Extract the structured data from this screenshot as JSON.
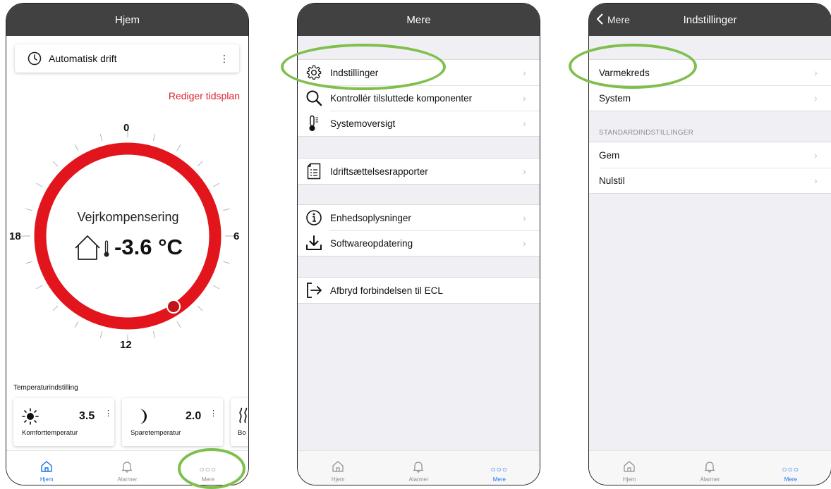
{
  "screen1": {
    "title": "Hjem",
    "mode_label": "Automatisk drift",
    "edit_schedule": "Rediger tidsplan",
    "dial": {
      "ticks": {
        "top": "0",
        "right": "6",
        "bottom": "12",
        "left": "18"
      },
      "title": "Vejrkompensering",
      "temperature": "-3.6 °C"
    },
    "section_label": "Temperaturindstilling",
    "cards": [
      {
        "value": "3.5",
        "name": "Komforttemperatur",
        "icon": "sun-icon"
      },
      {
        "value": "2.0",
        "name": "Sparetemperatur",
        "icon": "moon-icon"
      },
      {
        "value": "",
        "name": "Bo",
        "icon": "heat-waves-icon"
      }
    ]
  },
  "screen2": {
    "title": "Mere",
    "groups": [
      [
        {
          "label": "Indstillinger",
          "icon": "gear-icon"
        },
        {
          "label": "Kontrollér tilsluttede komponenter",
          "icon": "search-icon"
        },
        {
          "label": "Systemoversigt",
          "icon": "thermometer-icon"
        }
      ],
      [
        {
          "label": "Idriftsættelsesrapporter",
          "icon": "report-icon"
        }
      ],
      [
        {
          "label": "Enhedsoplysninger",
          "icon": "info-icon"
        },
        {
          "label": "Softwareopdatering",
          "icon": "download-icon"
        }
      ],
      [
        {
          "label": "Afbryd forbindelsen til ECL",
          "icon": "logout-icon"
        }
      ]
    ]
  },
  "screen3": {
    "title": "Indstillinger",
    "back_label": "Mere",
    "group1": [
      "Varmekreds",
      "System"
    ],
    "section_header": "STANDARDINDSTILLINGER",
    "group2": [
      "Gem",
      "Nulstil"
    ]
  },
  "tabs": [
    {
      "label": "Hjem",
      "icon": "home-icon"
    },
    {
      "label": "Alarmer",
      "icon": "bell-icon"
    },
    {
      "label": "Mere",
      "icon": "more-icon"
    }
  ],
  "colors": {
    "navbar": "#414141",
    "accent_red": "#d9232d",
    "active_tab": "#1a73e8",
    "highlight_ring": "#7fbf4d"
  }
}
